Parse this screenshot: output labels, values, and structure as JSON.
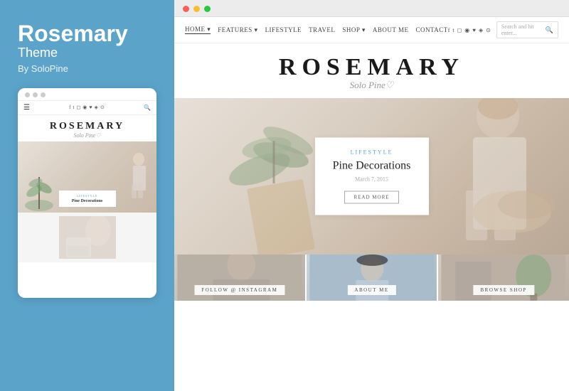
{
  "sidebar": {
    "title": "Rosemary",
    "subtitle": "Theme",
    "author": "By SoloPine"
  },
  "mobile_preview": {
    "logo_main": "ROSEMARY",
    "logo_sub": "Solo Pine",
    "hero_category": "LIFESTYLE",
    "hero_title": "Pine Decorations"
  },
  "browser": {
    "dots": [
      "red",
      "yellow",
      "green"
    ]
  },
  "website": {
    "nav": {
      "links": [
        {
          "label": "HOME",
          "active": true
        },
        {
          "label": "FEATURES"
        },
        {
          "label": "LIFESTYLE"
        },
        {
          "label": "TRAVEL"
        },
        {
          "label": "SHOP"
        },
        {
          "label": "ABOUT ME"
        },
        {
          "label": "CONTACT"
        }
      ],
      "search_placeholder": "Search and hit enter..."
    },
    "logo_main": "ROSEMARY",
    "logo_sub": "Solo Pine♡",
    "hero": {
      "category": "LIFESTYLE",
      "title": "Pine Decorations",
      "date": "March 7, 2015",
      "button": "READ MORE"
    },
    "bottom_panels": [
      {
        "label": "FOLLOW @ INSTAGRAM"
      },
      {
        "label": "ABOUT ME"
      },
      {
        "label": "BROWSE SHOP"
      }
    ]
  },
  "colors": {
    "sidebar_bg": "#5ba3c9",
    "accent": "#5ba3c9"
  }
}
